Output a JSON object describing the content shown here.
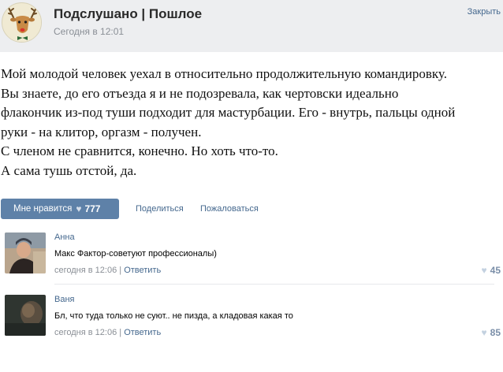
{
  "header": {
    "group_name": "Подслушано | Пошлое",
    "post_date": "Сегодня в 12:01",
    "close_label": "Закрыть"
  },
  "post": {
    "lines": [
      "Мой молодой человек уехал в относительно продолжительную командировку.",
      "Вы знаете, до его отъезда я и не подозревала, как чертовски идеально",
      "флакончик из-под туши подходит для мастурбации. Его - внутрь, пальцы одной",
      "руки - на клитор, оргазм - получен.",
      "С членом не сравнится, конечно. Но хоть что-то.",
      "А сама тушь отстой, да."
    ]
  },
  "actions": {
    "like_label": "Мне нравится",
    "like_count": "777",
    "share_label": "Поделиться",
    "report_label": "Пожаловаться"
  },
  "comments": [
    {
      "author": "Анна",
      "text": "Макс Фактор-советуют профессионалы)",
      "time": "сегодня в 12:06",
      "separator": " | ",
      "reply_label": "Ответить",
      "likes": "45"
    },
    {
      "author": "Ваня",
      "text": "Бл, что туда только не суют.. не пизда, а кладовая какая то",
      "time": "сегодня в 12:06",
      "separator": " | ",
      "reply_label": "Ответить",
      "likes": "85"
    }
  ],
  "colors": {
    "link": "#45688e",
    "like_button": "#5e81a8",
    "header_bg": "#edeef0",
    "meta_gray": "#8a8f96"
  }
}
